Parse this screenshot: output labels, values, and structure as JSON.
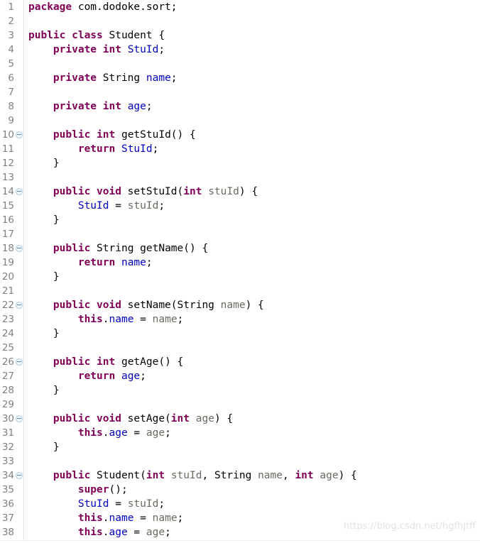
{
  "editor": {
    "language": "java",
    "line_height_px": 20,
    "first_visible_line": 1,
    "last_visible_line": 38,
    "colors": {
      "background": "#ffffff",
      "gutter_text": "#808080",
      "keyword": "#7f0055",
      "field": "#0000c0",
      "parameter": "#6a6a5f",
      "plain": "#000000",
      "fold_marker": "#a8c6e0",
      "watermark": "#e2e2e2"
    },
    "fold_marker_glyph": "collapse-minus-circle",
    "folded_lines": [
      10,
      14,
      18,
      22,
      26,
      30,
      34
    ]
  },
  "watermark": {
    "text": "https://blog.csdn.net/hgfhjtff"
  },
  "lines": [
    {
      "n": 1,
      "fold": false,
      "tokens": [
        {
          "t": "kw",
          "v": "package"
        },
        {
          "t": "pln",
          "v": " com.dodoke.sort;"
        }
      ]
    },
    {
      "n": 2,
      "fold": false,
      "tokens": []
    },
    {
      "n": 3,
      "fold": false,
      "tokens": [
        {
          "t": "kw",
          "v": "public class"
        },
        {
          "t": "pln",
          "v": " Student {"
        }
      ]
    },
    {
      "n": 4,
      "fold": false,
      "tokens": [
        {
          "t": "pln",
          "v": "    "
        },
        {
          "t": "kw",
          "v": "private int"
        },
        {
          "t": "pln",
          "v": " "
        },
        {
          "t": "fld",
          "v": "StuId"
        },
        {
          "t": "pln",
          "v": ";"
        }
      ]
    },
    {
      "n": 5,
      "fold": false,
      "tokens": []
    },
    {
      "n": 6,
      "fold": false,
      "tokens": [
        {
          "t": "pln",
          "v": "    "
        },
        {
          "t": "kw",
          "v": "private"
        },
        {
          "t": "pln",
          "v": " String "
        },
        {
          "t": "fld",
          "v": "name"
        },
        {
          "t": "pln",
          "v": ";"
        }
      ]
    },
    {
      "n": 7,
      "fold": false,
      "tokens": []
    },
    {
      "n": 8,
      "fold": false,
      "tokens": [
        {
          "t": "pln",
          "v": "    "
        },
        {
          "t": "kw",
          "v": "private int"
        },
        {
          "t": "pln",
          "v": " "
        },
        {
          "t": "fld",
          "v": "age"
        },
        {
          "t": "pln",
          "v": ";"
        }
      ]
    },
    {
      "n": 9,
      "fold": false,
      "tokens": []
    },
    {
      "n": 10,
      "fold": true,
      "tokens": [
        {
          "t": "pln",
          "v": "    "
        },
        {
          "t": "kw",
          "v": "public int"
        },
        {
          "t": "pln",
          "v": " getStuId() {"
        }
      ]
    },
    {
      "n": 11,
      "fold": false,
      "tokens": [
        {
          "t": "pln",
          "v": "        "
        },
        {
          "t": "kw",
          "v": "return"
        },
        {
          "t": "pln",
          "v": " "
        },
        {
          "t": "fld",
          "v": "StuId"
        },
        {
          "t": "pln",
          "v": ";"
        }
      ]
    },
    {
      "n": 12,
      "fold": false,
      "tokens": [
        {
          "t": "pln",
          "v": "    }"
        }
      ]
    },
    {
      "n": 13,
      "fold": false,
      "tokens": []
    },
    {
      "n": 14,
      "fold": true,
      "tokens": [
        {
          "t": "pln",
          "v": "    "
        },
        {
          "t": "kw",
          "v": "public void"
        },
        {
          "t": "pln",
          "v": " setStuId("
        },
        {
          "t": "kw",
          "v": "int"
        },
        {
          "t": "pln",
          "v": " "
        },
        {
          "t": "par",
          "v": "stuId"
        },
        {
          "t": "pln",
          "v": ") {"
        }
      ]
    },
    {
      "n": 15,
      "fold": false,
      "tokens": [
        {
          "t": "pln",
          "v": "        "
        },
        {
          "t": "fld",
          "v": "StuId"
        },
        {
          "t": "pln",
          "v": " = "
        },
        {
          "t": "par",
          "v": "stuId"
        },
        {
          "t": "pln",
          "v": ";"
        }
      ]
    },
    {
      "n": 16,
      "fold": false,
      "tokens": [
        {
          "t": "pln",
          "v": "    }"
        }
      ]
    },
    {
      "n": 17,
      "fold": false,
      "tokens": []
    },
    {
      "n": 18,
      "fold": true,
      "tokens": [
        {
          "t": "pln",
          "v": "    "
        },
        {
          "t": "kw",
          "v": "public"
        },
        {
          "t": "pln",
          "v": " String getName() {"
        }
      ]
    },
    {
      "n": 19,
      "fold": false,
      "tokens": [
        {
          "t": "pln",
          "v": "        "
        },
        {
          "t": "kw",
          "v": "return"
        },
        {
          "t": "pln",
          "v": " "
        },
        {
          "t": "fld",
          "v": "name"
        },
        {
          "t": "pln",
          "v": ";"
        }
      ]
    },
    {
      "n": 20,
      "fold": false,
      "tokens": [
        {
          "t": "pln",
          "v": "    }"
        }
      ]
    },
    {
      "n": 21,
      "fold": false,
      "tokens": []
    },
    {
      "n": 22,
      "fold": true,
      "tokens": [
        {
          "t": "pln",
          "v": "    "
        },
        {
          "t": "kw",
          "v": "public void"
        },
        {
          "t": "pln",
          "v": " setName(String "
        },
        {
          "t": "par",
          "v": "name"
        },
        {
          "t": "pln",
          "v": ") {"
        }
      ]
    },
    {
      "n": 23,
      "fold": false,
      "tokens": [
        {
          "t": "pln",
          "v": "        "
        },
        {
          "t": "kw",
          "v": "this"
        },
        {
          "t": "pln",
          "v": "."
        },
        {
          "t": "fld",
          "v": "name"
        },
        {
          "t": "pln",
          "v": " = "
        },
        {
          "t": "par",
          "v": "name"
        },
        {
          "t": "pln",
          "v": ";"
        }
      ]
    },
    {
      "n": 24,
      "fold": false,
      "tokens": [
        {
          "t": "pln",
          "v": "    }"
        }
      ]
    },
    {
      "n": 25,
      "fold": false,
      "tokens": []
    },
    {
      "n": 26,
      "fold": true,
      "tokens": [
        {
          "t": "pln",
          "v": "    "
        },
        {
          "t": "kw",
          "v": "public int"
        },
        {
          "t": "pln",
          "v": " getAge() {"
        }
      ]
    },
    {
      "n": 27,
      "fold": false,
      "tokens": [
        {
          "t": "pln",
          "v": "        "
        },
        {
          "t": "kw",
          "v": "return"
        },
        {
          "t": "pln",
          "v": " "
        },
        {
          "t": "fld",
          "v": "age"
        },
        {
          "t": "pln",
          "v": ";"
        }
      ]
    },
    {
      "n": 28,
      "fold": false,
      "tokens": [
        {
          "t": "pln",
          "v": "    }"
        }
      ]
    },
    {
      "n": 29,
      "fold": false,
      "tokens": []
    },
    {
      "n": 30,
      "fold": true,
      "tokens": [
        {
          "t": "pln",
          "v": "    "
        },
        {
          "t": "kw",
          "v": "public void"
        },
        {
          "t": "pln",
          "v": " setAge("
        },
        {
          "t": "kw",
          "v": "int"
        },
        {
          "t": "pln",
          "v": " "
        },
        {
          "t": "par",
          "v": "age"
        },
        {
          "t": "pln",
          "v": ") {"
        }
      ]
    },
    {
      "n": 31,
      "fold": false,
      "tokens": [
        {
          "t": "pln",
          "v": "        "
        },
        {
          "t": "kw",
          "v": "this"
        },
        {
          "t": "pln",
          "v": "."
        },
        {
          "t": "fld",
          "v": "age"
        },
        {
          "t": "pln",
          "v": " = "
        },
        {
          "t": "par",
          "v": "age"
        },
        {
          "t": "pln",
          "v": ";"
        }
      ]
    },
    {
      "n": 32,
      "fold": false,
      "tokens": [
        {
          "t": "pln",
          "v": "    }"
        }
      ]
    },
    {
      "n": 33,
      "fold": false,
      "tokens": []
    },
    {
      "n": 34,
      "fold": true,
      "tokens": [
        {
          "t": "pln",
          "v": "    "
        },
        {
          "t": "kw",
          "v": "public"
        },
        {
          "t": "pln",
          "v": " Student("
        },
        {
          "t": "kw",
          "v": "int"
        },
        {
          "t": "pln",
          "v": " "
        },
        {
          "t": "par",
          "v": "stuId"
        },
        {
          "t": "pln",
          "v": ", String "
        },
        {
          "t": "par",
          "v": "name"
        },
        {
          "t": "pln",
          "v": ", "
        },
        {
          "t": "kw",
          "v": "int"
        },
        {
          "t": "pln",
          "v": " "
        },
        {
          "t": "par",
          "v": "age"
        },
        {
          "t": "pln",
          "v": ") {"
        }
      ]
    },
    {
      "n": 35,
      "fold": false,
      "tokens": [
        {
          "t": "pln",
          "v": "        "
        },
        {
          "t": "kw",
          "v": "super"
        },
        {
          "t": "pln",
          "v": "();"
        }
      ]
    },
    {
      "n": 36,
      "fold": false,
      "tokens": [
        {
          "t": "pln",
          "v": "        "
        },
        {
          "t": "fld",
          "v": "StuId"
        },
        {
          "t": "pln",
          "v": " = "
        },
        {
          "t": "par",
          "v": "stuId"
        },
        {
          "t": "pln",
          "v": ";"
        }
      ]
    },
    {
      "n": 37,
      "fold": false,
      "tokens": [
        {
          "t": "pln",
          "v": "        "
        },
        {
          "t": "kw",
          "v": "this"
        },
        {
          "t": "pln",
          "v": "."
        },
        {
          "t": "fld",
          "v": "name"
        },
        {
          "t": "pln",
          "v": " = "
        },
        {
          "t": "par",
          "v": "name"
        },
        {
          "t": "pln",
          "v": ";"
        }
      ]
    },
    {
      "n": 38,
      "fold": false,
      "tokens": [
        {
          "t": "pln",
          "v": "        "
        },
        {
          "t": "kw",
          "v": "this"
        },
        {
          "t": "pln",
          "v": "."
        },
        {
          "t": "fld",
          "v": "age"
        },
        {
          "t": "pln",
          "v": " = "
        },
        {
          "t": "par",
          "v": "age"
        },
        {
          "t": "pln",
          "v": ";"
        }
      ]
    }
  ]
}
